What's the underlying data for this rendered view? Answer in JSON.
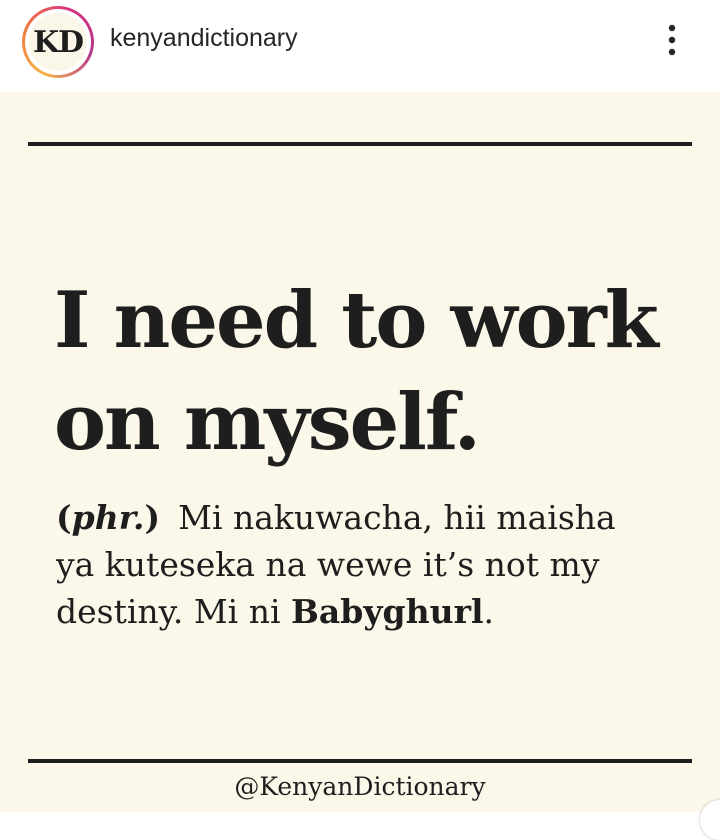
{
  "header": {
    "avatar_text": "KD",
    "username": "kenyandictionary",
    "more_icon": "more-vertical-icon"
  },
  "post": {
    "headline_line1": "I need to work",
    "headline_line2": "on myself.",
    "part_of_speech": "phr.",
    "definition_text_1": "Mi nakuwacha, hii maisha",
    "definition_text_2": "ya kuteseka na wewe it’s not my",
    "definition_text_3": "destiny. Mi ni ",
    "definition_term": "Babyghurl",
    "definition_end": ".",
    "handle": "@KenyanDictionary"
  },
  "colors": {
    "post_background": "#fbf8e9",
    "text": "#1e1e1e",
    "story_ring_start": "#f7b24a",
    "story_ring_end": "#d9347f"
  }
}
